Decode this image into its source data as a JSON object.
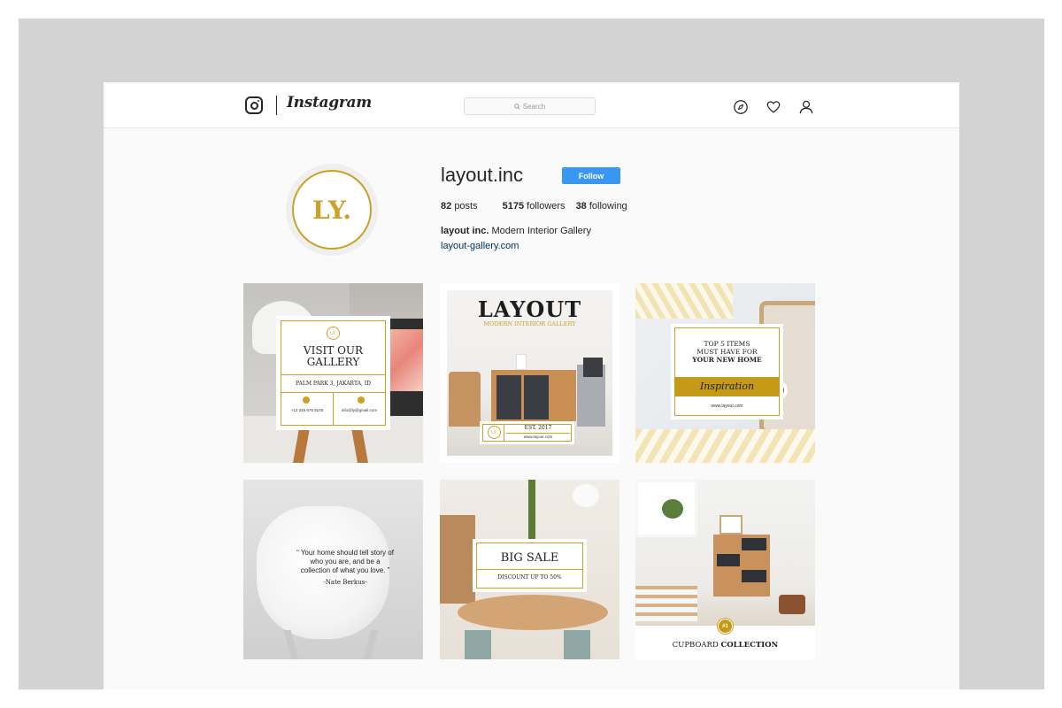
{
  "app": {
    "brand": "Instagram",
    "search_placeholder": "Search",
    "accent_color": "#3897f0",
    "gold_color": "#c9a227",
    "nav_icons": [
      "compass-icon",
      "heart-icon",
      "person-icon"
    ]
  },
  "profile": {
    "avatar_text": "LY.",
    "username": "layout.inc",
    "follow_label": "Follow",
    "posts_count": "82",
    "posts_label": "posts",
    "followers_count": "5175",
    "followers_label": "followers",
    "following_count": "38",
    "following_label": "following",
    "bio_name": "layout inc.",
    "bio_text": "Modern Interior Gallery",
    "website": "layout-gallery.com"
  },
  "posts": [
    {
      "logo": "LY.",
      "title_line1": "VISIT OUR",
      "title_line2": "GALLERY",
      "address": "PALM PARK 3, JAKARTA, ID",
      "phone": "+12 345 678 9100",
      "email": "info@ly@gmail.com"
    },
    {
      "title": "LAYOUT",
      "subtitle": "MODERN INTERIOR GALLERY",
      "logo": "LY.",
      "est": "EST. 2017",
      "url": "www.layout.com"
    },
    {
      "line1": "TOP 5 ITEMS",
      "line2": "MUST HAVE FOR",
      "line3": "YOUR NEW HOME",
      "script": "Inspiration",
      "url": "www.layout.com"
    },
    {
      "quote_line1": "“ Your home should tell story of",
      "quote_line2": "who you are, and be a",
      "quote_line3": "collection of what you love. ”",
      "author": "-Nate Berkus-"
    },
    {
      "title": "BIG SALE",
      "subtitle": "DISCOUNT UP TO 50%"
    },
    {
      "badge": "#1",
      "title_light": "CUPBOARD",
      "title_bold": "COLLECTION"
    }
  ]
}
